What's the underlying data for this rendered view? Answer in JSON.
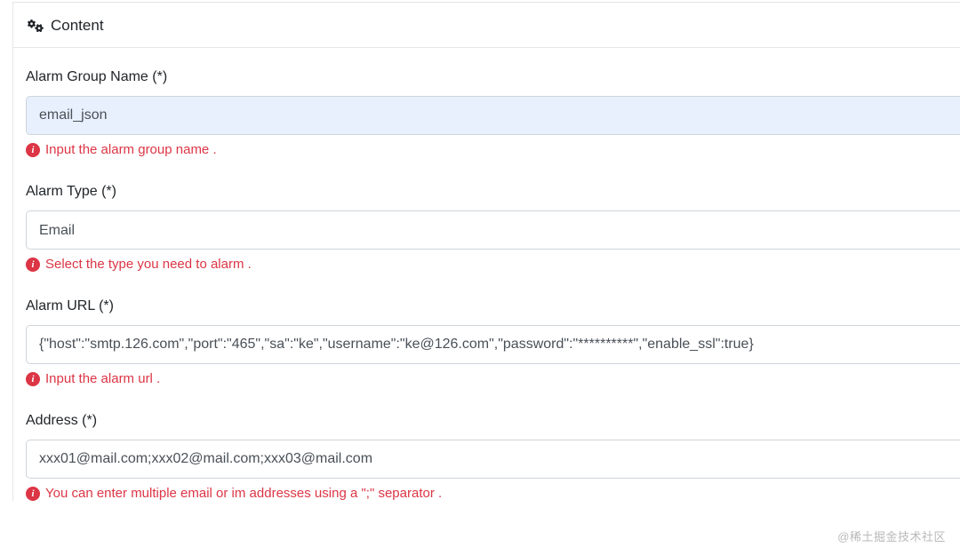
{
  "panel": {
    "title": "Content"
  },
  "form": {
    "group_name": {
      "label": "Alarm Group Name (*)",
      "value": "email_json",
      "help": "Input the alarm group name ."
    },
    "alarm_type": {
      "label": "Alarm Type (*)",
      "value": "Email",
      "help": "Select the type you need to alarm ."
    },
    "alarm_url": {
      "label": "Alarm URL (*)",
      "value": "{\"host\":\"smtp.126.com\",\"port\":\"465\",\"sa\":\"ke\",\"username\":\"ke@126.com\",\"password\":\"**********\",\"enable_ssl\":true}",
      "help": "Input the alarm url ."
    },
    "address": {
      "label": "Address (*)",
      "value": "xxx01@mail.com;xxx02@mail.com;xxx03@mail.com",
      "help": "You can enter multiple email or im addresses using a \";\" separator ."
    }
  },
  "watermark": "@稀土掘金技术社区"
}
